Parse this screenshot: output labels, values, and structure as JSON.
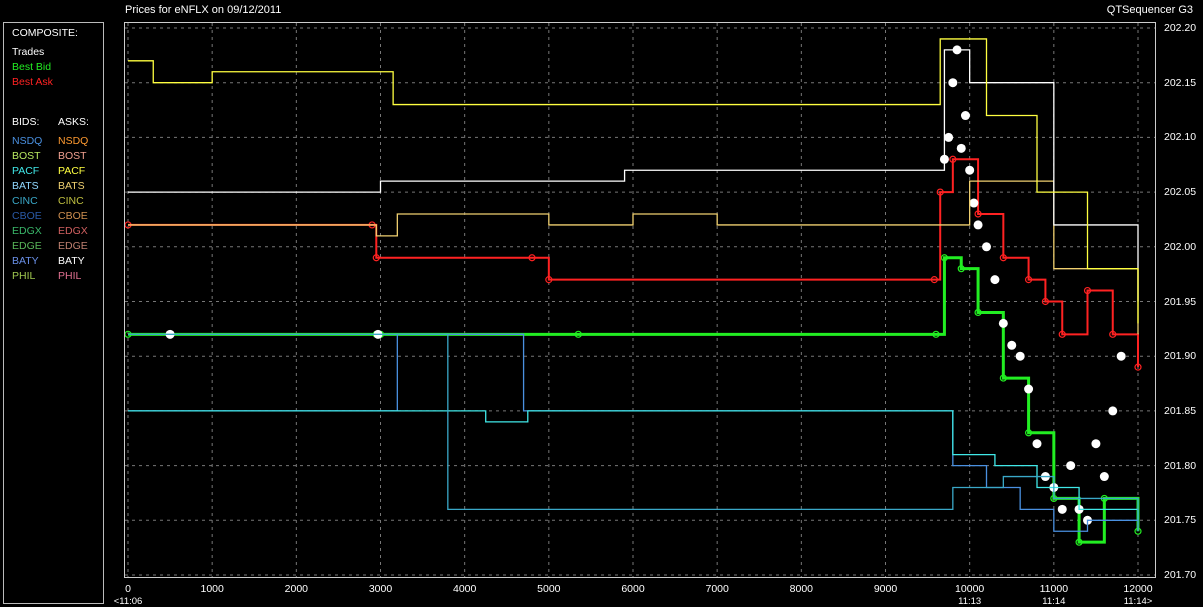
{
  "header": {
    "title": "Prices for  eNFLX  on  09/12/2011",
    "app": "QTSequencer G3"
  },
  "legend": {
    "composite_heading": "COMPOSITE:",
    "composite": [
      {
        "label": "Trades",
        "color": "#ffffff"
      },
      {
        "label": "Best Bid",
        "color": "#22ee22"
      },
      {
        "label": "Best Ask",
        "color": "#ff2222"
      }
    ],
    "bids_heading": "BIDS:",
    "asks_heading": "ASKS:",
    "bids": [
      {
        "label": "NSDQ",
        "color": "#4a90e0"
      },
      {
        "label": "BOST",
        "color": "#b8e860"
      },
      {
        "label": "PACF",
        "color": "#40e8e8"
      },
      {
        "label": "BATS",
        "color": "#90d8ff"
      },
      {
        "label": "CINC",
        "color": "#3aa8c8"
      },
      {
        "label": "CBOE",
        "color": "#2a5aa8"
      },
      {
        "label": "EDGX",
        "color": "#3ab86a"
      },
      {
        "label": "EDGE",
        "color": "#5ab85a"
      },
      {
        "label": "BATY",
        "color": "#6a90e8"
      },
      {
        "label": "PHIL",
        "color": "#a0c850"
      }
    ],
    "asks": [
      {
        "label": "NSDQ",
        "color": "#ff9a30"
      },
      {
        "label": "BOST",
        "color": "#f0a090"
      },
      {
        "label": "PACF",
        "color": "#ffff40"
      },
      {
        "label": "BATS",
        "color": "#f0d070"
      },
      {
        "label": "CINC",
        "color": "#c0c040"
      },
      {
        "label": "CBOE",
        "color": "#d09050"
      },
      {
        "label": "EDGX",
        "color": "#d06060"
      },
      {
        "label": "EDGE",
        "color": "#c08070"
      },
      {
        "label": "BATY",
        "color": "#ffffff"
      },
      {
        "label": "PHIL",
        "color": "#e07090"
      }
    ]
  },
  "chart_data": {
    "type": "line",
    "background": "#000000",
    "grid": true,
    "legend_placement": "left panel",
    "xlim": [
      0,
      12000
    ],
    "ylim": [
      201.7,
      202.2
    ],
    "x_ticks": [
      0,
      1000,
      2000,
      3000,
      4000,
      5000,
      6000,
      7000,
      8000,
      9000,
      10000,
      11000,
      12000
    ],
    "time_labels": [
      {
        "x": 0,
        "label": "<11:06"
      },
      {
        "x": 10000,
        "label": "11:13"
      },
      {
        "x": 11000,
        "label": "11:14"
      },
      {
        "x": 12000,
        "label": "11:14>"
      }
    ],
    "y_ticks": [
      202.2,
      202.15,
      202.1,
      202.05,
      202.0,
      201.95,
      201.9,
      201.85,
      201.8,
      201.75,
      201.7
    ],
    "series": [
      {
        "name": "Best Bid",
        "color": "#22ee22",
        "x": [
          0,
          2950,
          3000,
          5350,
          9600,
          9700,
          9900,
          10100,
          10400,
          10700,
          11000,
          11300,
          11600,
          12000
        ],
        "y": [
          201.92,
          201.92,
          201.92,
          201.92,
          201.92,
          201.99,
          201.98,
          201.94,
          201.88,
          201.83,
          201.77,
          201.73,
          201.77,
          201.74
        ]
      },
      {
        "name": "Best Ask",
        "color": "#ff2222",
        "x": [
          0,
          2900,
          2950,
          4800,
          5000,
          9580,
          9650,
          9800,
          10100,
          10400,
          10700,
          10900,
          11100,
          11400,
          11700,
          12000
        ],
        "y": [
          202.02,
          202.02,
          201.99,
          201.99,
          201.97,
          201.97,
          202.05,
          202.08,
          202.03,
          201.99,
          201.97,
          201.95,
          201.92,
          201.96,
          201.92,
          201.89
        ]
      },
      {
        "name": "Trades",
        "color": "#ffffff",
        "x": [
          500,
          2970,
          9700,
          9750,
          9800,
          9850,
          9900,
          9950,
          10000,
          10050,
          10100,
          10200,
          10300,
          10400,
          10500,
          10600,
          10700,
          10800,
          10900,
          11000,
          11100,
          11200,
          11300,
          11400,
          11500,
          11600,
          11700,
          11800
        ],
        "y": [
          201.92,
          201.92,
          202.08,
          202.1,
          202.15,
          202.18,
          202.09,
          202.12,
          202.07,
          202.04,
          202.02,
          202.0,
          201.97,
          201.93,
          201.91,
          201.9,
          201.87,
          201.82,
          201.79,
          201.78,
          201.76,
          201.8,
          201.76,
          201.75,
          201.82,
          201.79,
          201.85,
          201.9
        ]
      },
      {
        "name": "NSDQ",
        "color": "#4a90e0",
        "x": [
          0,
          2950,
          3200,
          4200,
          4700,
          5000,
          5400,
          9600,
          9800,
          10200,
          10600,
          11000,
          11400,
          12000
        ],
        "y": [
          201.85,
          201.85,
          201.92,
          201.92,
          201.85,
          201.85,
          201.85,
          201.85,
          201.8,
          201.78,
          201.76,
          201.74,
          201.75,
          201.74
        ]
      },
      {
        "name": "PACF",
        "color": "#40e8e8",
        "x": [
          0,
          3000,
          4200,
          4250,
          4700,
          4750,
          9600,
          9800,
          10300,
          10800,
          11300,
          12000
        ],
        "y": [
          201.85,
          201.85,
          201.85,
          201.84,
          201.84,
          201.85,
          201.85,
          201.81,
          201.8,
          201.78,
          201.76,
          201.75
        ]
      },
      {
        "name": "CINC",
        "color": "#3aa8c8",
        "x": [
          0,
          2950,
          3800,
          3800,
          4900,
          9600,
          9800,
          10400,
          11000,
          12000
        ],
        "y": [
          201.92,
          201.92,
          201.92,
          201.76,
          201.76,
          201.76,
          201.78,
          201.79,
          201.77,
          201.75
        ]
      },
      {
        "name": "BATS",
        "color": "#f0d070",
        "x": [
          0,
          2950,
          3200,
          4000,
          5000,
          6000,
          7000,
          8000,
          9600,
          10000,
          11000,
          12000
        ],
        "y": [
          202.02,
          202.01,
          202.03,
          202.03,
          202.02,
          202.03,
          202.02,
          202.02,
          202.02,
          202.06,
          201.98,
          201.92
        ]
      },
      {
        "name": "BATY",
        "color": "#ffffff",
        "x": [
          0,
          2950,
          3000,
          5800,
          5900,
          9600,
          9700,
          10000,
          11000,
          12000
        ],
        "y": [
          202.05,
          202.05,
          202.06,
          202.06,
          202.07,
          202.07,
          202.18,
          202.15,
          202.02,
          201.95
        ]
      },
      {
        "name": "PACF ask",
        "color": "#ffff40",
        "x": [
          0,
          300,
          300,
          1000,
          1000,
          3150,
          3150,
          9600,
          9650,
          10200,
          10800,
          11400,
          12000
        ],
        "y": [
          202.17,
          202.17,
          202.15,
          202.15,
          202.16,
          202.16,
          202.13,
          202.13,
          202.19,
          202.12,
          202.05,
          201.98,
          201.93
        ]
      }
    ]
  }
}
